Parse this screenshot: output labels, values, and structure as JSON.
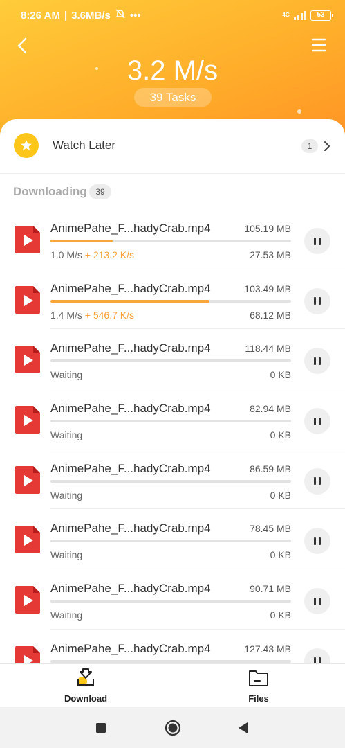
{
  "status_bar": {
    "time": "8:26 AM",
    "net_speed": "3.6MB/s",
    "network_type": "4G",
    "battery": "53"
  },
  "header": {
    "total_speed": "3.2 M/s",
    "tasks_label": "39 Tasks"
  },
  "watch_later": {
    "label": "Watch Later",
    "count": "1"
  },
  "downloading": {
    "label": "Downloading",
    "count": "39"
  },
  "items": [
    {
      "name": "AnimePahe_F...hadyCrab.mp4",
      "size": "105.19 MB",
      "speed": "1.0 M/s",
      "boost": "+ 213.2 K/s",
      "downloaded": "27.53 MB",
      "progress": 0.26
    },
    {
      "name": "AnimePahe_F...hadyCrab.mp4",
      "size": "103.49 MB",
      "speed": "1.4 M/s",
      "boost": "+ 546.7 K/s",
      "downloaded": "68.12 MB",
      "progress": 0.66
    },
    {
      "name": "AnimePahe_F...hadyCrab.mp4",
      "size": "118.44 MB",
      "speed": "Waiting",
      "boost": "",
      "downloaded": "0 KB",
      "progress": 0
    },
    {
      "name": "AnimePahe_F...hadyCrab.mp4",
      "size": "82.94 MB",
      "speed": "Waiting",
      "boost": "",
      "downloaded": "0 KB",
      "progress": 0
    },
    {
      "name": "AnimePahe_F...hadyCrab.mp4",
      "size": "86.59 MB",
      "speed": "Waiting",
      "boost": "",
      "downloaded": "0 KB",
      "progress": 0
    },
    {
      "name": "AnimePahe_F...hadyCrab.mp4",
      "size": "78.45 MB",
      "speed": "Waiting",
      "boost": "",
      "downloaded": "0 KB",
      "progress": 0
    },
    {
      "name": "AnimePahe_F...hadyCrab.mp4",
      "size": "90.71 MB",
      "speed": "Waiting",
      "boost": "",
      "downloaded": "0 KB",
      "progress": 0
    },
    {
      "name": "AnimePahe_F...hadyCrab.mp4",
      "size": "127.43 MB",
      "speed": "Waiting",
      "boost": "",
      "downloaded": "0 KB",
      "progress": 0
    }
  ],
  "bottom_nav": {
    "download_label": "Download",
    "files_label": "Files"
  },
  "icons": [
    "back-arrow-icon",
    "menu-icon",
    "star-icon",
    "chevron-right-icon",
    "video-file-icon",
    "pause-icon",
    "download-icon",
    "folder-icon",
    "square-icon",
    "circle-icon",
    "triangle-back-icon"
  ],
  "colors": {
    "accent": "#f7a63a",
    "header_start": "#ffcc3a",
    "header_end": "#ff8f24",
    "file_icon": "#e53935"
  }
}
